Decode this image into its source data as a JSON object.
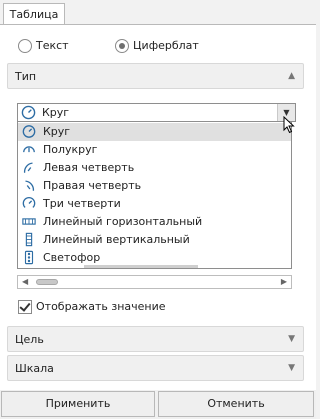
{
  "tabs": [
    {
      "label": "Таблица"
    }
  ],
  "radios": {
    "option1": {
      "label": "Текст",
      "selected": false
    },
    "option2": {
      "label": "Циферблат",
      "selected": true
    }
  },
  "sections": {
    "type": {
      "title": "Тип",
      "expanded": true
    },
    "target": {
      "title": "Цель"
    },
    "scale": {
      "title": "Шкала"
    }
  },
  "combo": {
    "value": "Круг",
    "icon": "gauge-circle-icon"
  },
  "dropdown": {
    "items": [
      {
        "label": "Круг",
        "icon": "gauge-circle-icon",
        "selected": true
      },
      {
        "label": "Полукруг",
        "icon": "gauge-half-icon"
      },
      {
        "label": "Левая четверть",
        "icon": "gauge-left-quarter-icon"
      },
      {
        "label": "Правая четверть",
        "icon": "gauge-right-quarter-icon"
      },
      {
        "label": "Три четверти",
        "icon": "gauge-three-quarter-icon"
      },
      {
        "label": "Линейный горизонтальный",
        "icon": "linear-horizontal-icon"
      },
      {
        "label": "Линейный вертикальный",
        "icon": "linear-vertical-icon"
      },
      {
        "label": "Светофор",
        "icon": "traffic-light-icon"
      }
    ]
  },
  "show_value": {
    "label": "Отображать значение",
    "checked": true
  },
  "buttons": {
    "apply": "Применить",
    "cancel": "Отменить"
  },
  "colors": {
    "icon": "#2e6da4",
    "accent": "#6f6f6f"
  }
}
